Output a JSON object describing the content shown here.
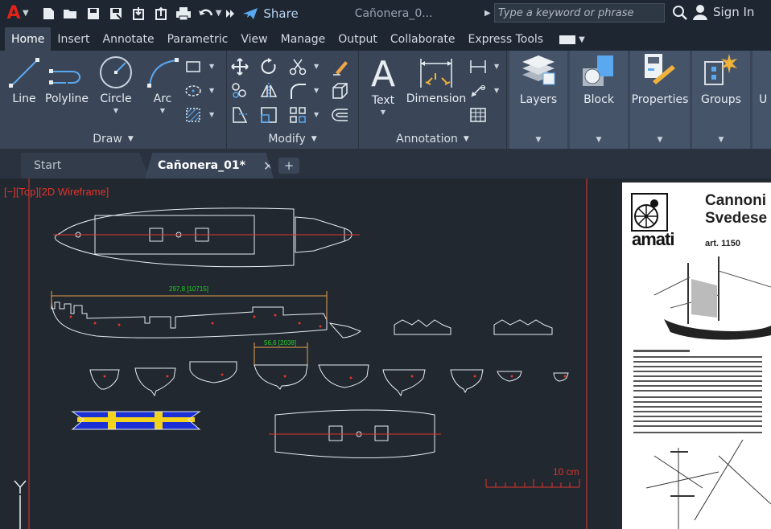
{
  "app": {
    "logo": "A",
    "share_label": "Share",
    "doc_title": "Cañonera_0...",
    "search_placeholder": "Type a keyword or phrase",
    "signin_label": "Sign In"
  },
  "ribbon_tabs": [
    "Home",
    "Insert",
    "Annotate",
    "Parametric",
    "View",
    "Manage",
    "Output",
    "Collaborate",
    "Express Tools"
  ],
  "panels": {
    "draw": {
      "title": "Draw",
      "tools": [
        "Line",
        "Polyline",
        "Circle",
        "Arc"
      ]
    },
    "modify": {
      "title": "Modify"
    },
    "annotation": {
      "title": "Annotation",
      "tools": [
        "Text",
        "Dimension"
      ]
    },
    "big": [
      "Layers",
      "Block",
      "Properties",
      "Groups",
      "U"
    ]
  },
  "doc_tabs": {
    "start": "Start",
    "active": "Cañonera_01*",
    "close": "✕",
    "plus": "+"
  },
  "viewport": {
    "label": "[−][Top][2D Wireframe]",
    "dim_1": "297,8 [10715]",
    "dim_2": "56,6 [2038]",
    "scale": "10 cm",
    "ucs": "Y"
  },
  "reference": {
    "logo": "amati",
    "title_line1": "Cannoni",
    "title_line2": "Svedese",
    "art": "art. 1150"
  },
  "colors": {
    "accent_red": "#e0342b",
    "dim_green": "#1fd21f",
    "dim_orange": "#e8a24a",
    "flag_blue": "#1b2fd6",
    "flag_yellow": "#f2d21b"
  }
}
